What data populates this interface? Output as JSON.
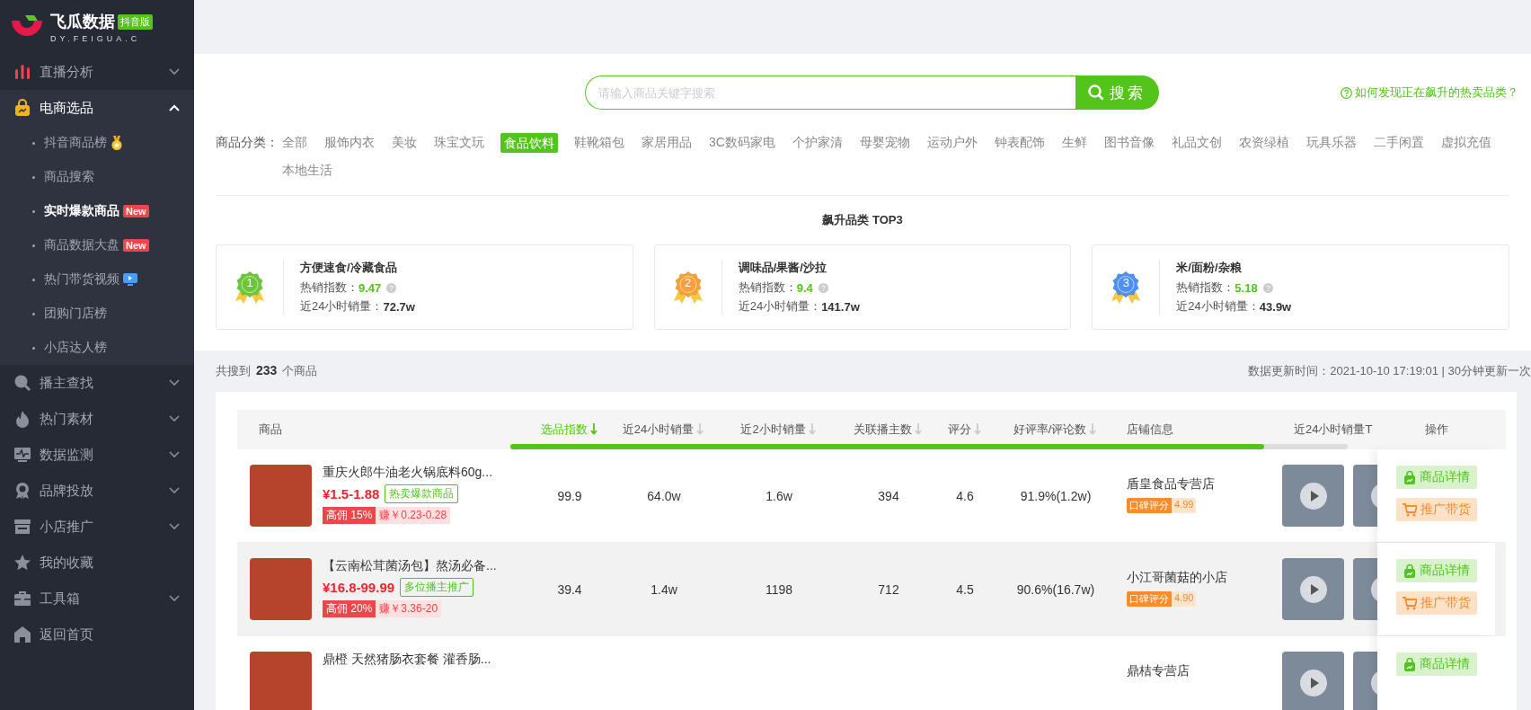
{
  "sidebar": {
    "logo": {
      "name": "飞瓜数据",
      "badge": "抖音版",
      "domain": "DY.FEIGUA.C"
    },
    "items": [
      {
        "label": "直播分析",
        "kind": "group",
        "expanded": false
      },
      {
        "label": "电商选品",
        "kind": "group",
        "expanded": true,
        "children": [
          {
            "label": "抖音商品榜",
            "kind": "medal",
            "selected": false
          },
          {
            "label": "商品搜索",
            "kind": "plain",
            "selected": false
          },
          {
            "label": "实时爆款商品",
            "kind": "new",
            "badge": "New",
            "selected": true
          },
          {
            "label": "商品数据大盘",
            "kind": "new",
            "badge": "New",
            "selected": false
          },
          {
            "label": "热门带货视频",
            "kind": "video",
            "selected": false
          },
          {
            "label": "团购门店榜",
            "kind": "plain",
            "selected": false
          },
          {
            "label": "小店达人榜",
            "kind": "plain",
            "selected": false
          }
        ]
      },
      {
        "label": "播主查找",
        "kind": "group",
        "expanded": false
      },
      {
        "label": "热门素材",
        "kind": "group",
        "expanded": false
      },
      {
        "label": "数据监测",
        "kind": "group",
        "expanded": false
      },
      {
        "label": "品牌投放",
        "kind": "group",
        "expanded": false
      },
      {
        "label": "小店推广",
        "kind": "group",
        "expanded": false
      },
      {
        "label": "我的收藏",
        "kind": "link"
      },
      {
        "label": "工具箱",
        "kind": "group",
        "expanded": false
      },
      {
        "label": "返回首页",
        "kind": "link"
      }
    ]
  },
  "search": {
    "placeholder": "请输入商品关键字搜索",
    "button": "搜索"
  },
  "help_link": "如何发现正在飙升的热卖品类？",
  "categories": {
    "label": "商品分类：",
    "items": [
      {
        "label": "全部",
        "selected": false
      },
      {
        "label": "服饰内衣",
        "selected": false
      },
      {
        "label": "美妆",
        "selected": false
      },
      {
        "label": "珠宝文玩",
        "selected": false
      },
      {
        "label": "食品饮料",
        "selected": true
      },
      {
        "label": "鞋靴箱包",
        "selected": false
      },
      {
        "label": "家居用品",
        "selected": false
      },
      {
        "label": "3C数码家电",
        "selected": false
      },
      {
        "label": "个护家清",
        "selected": false
      },
      {
        "label": "母婴宠物",
        "selected": false
      },
      {
        "label": "运动户外",
        "selected": false
      },
      {
        "label": "钟表配饰",
        "selected": false
      },
      {
        "label": "生鲜",
        "selected": false
      },
      {
        "label": "图书音像",
        "selected": false
      },
      {
        "label": "礼品文创",
        "selected": false
      },
      {
        "label": "农资绿植",
        "selected": false
      },
      {
        "label": "玩具乐器",
        "selected": false
      },
      {
        "label": "二手闲置",
        "selected": false
      },
      {
        "label": "虚拟充值",
        "selected": false
      },
      {
        "label": "本地生活",
        "selected": false
      }
    ]
  },
  "top3": {
    "title": "飙升品类 TOP3",
    "cards": [
      {
        "rank": "1",
        "color": "#6cc63c",
        "name": "方便速食/冷藏食品",
        "index_label": "热销指数：",
        "index": "9.47",
        "sales_label": "近24小时销量：",
        "sales": "72.7w"
      },
      {
        "rank": "2",
        "color": "#f5a03a",
        "name": "调味品/果酱/沙拉",
        "index_label": "热销指数：",
        "index": "9.4",
        "sales_label": "近24小时销量：",
        "sales": "141.7w"
      },
      {
        "rank": "3",
        "color": "#4f8ff0",
        "name": "米/面粉/杂粮",
        "index_label": "热销指数：",
        "index": "5.18",
        "sales_label": "近24小时销量：",
        "sales": "43.9w"
      }
    ]
  },
  "result": {
    "prefix": "共搜到",
    "count": "233",
    "suffix": "个商品",
    "update": "数据更新时间：2021-10-10 17:19:01 | 30分钟更新一次"
  },
  "table": {
    "columns": [
      {
        "label": "商品",
        "sortable": false,
        "sorted": false
      },
      {
        "label": "选品指数",
        "sortable": true,
        "sorted": true
      },
      {
        "label": "近24小时销量",
        "sortable": true,
        "sorted": false
      },
      {
        "label": "近2小时销量",
        "sortable": true,
        "sorted": false
      },
      {
        "label": "关联播主数",
        "sortable": true,
        "sorted": false
      },
      {
        "label": "评分",
        "sortable": true,
        "sorted": false
      },
      {
        "label": "好评率/评论数",
        "sortable": true,
        "sorted": false
      },
      {
        "label": "店铺信息",
        "sortable": false,
        "sorted": false
      },
      {
        "label": "近24小时销量T",
        "sortable": false,
        "sorted": false
      }
    ],
    "ops_header": "操作",
    "rows": [
      {
        "highlighted": false,
        "title": "重庆火郎牛油老火锅底料60g...",
        "price": "¥1.5-1.88",
        "tag": "热卖爆款商品",
        "commission": "高佣 15%",
        "earn": "赚￥0.23-0.28",
        "index": "99.9",
        "sales_24h": "64.0w",
        "sales_2h": "1.6w",
        "streamers": "394",
        "rating": "4.6",
        "praise": "91.9%(1.2w)",
        "shop": "盾皇食品专营店",
        "shop_badge": "口碑评分",
        "shop_score": "4.99",
        "actions": [
          "商品详情",
          "推广带货"
        ]
      },
      {
        "highlighted": true,
        "title": "【云南松茸菌汤包】熬汤必备...",
        "price": "¥16.8-99.99",
        "tag": "多位播主推广",
        "commission": "高佣 20%",
        "earn": "赚￥3.36-20",
        "index": "39.4",
        "sales_24h": "1.4w",
        "sales_2h": "1198",
        "streamers": "712",
        "rating": "4.5",
        "praise": "90.6%(16.7w)",
        "shop": "小江哥菌菇的小店",
        "shop_badge": "口碑评分",
        "shop_score": "4.90",
        "actions": [
          "商品详情",
          "推广带货"
        ]
      },
      {
        "highlighted": false,
        "title": "鼎橙 天然猪肠衣套餐 灌香肠...",
        "shop": "鼎桔专营店",
        "actions": [
          "商品详情"
        ]
      }
    ]
  }
}
